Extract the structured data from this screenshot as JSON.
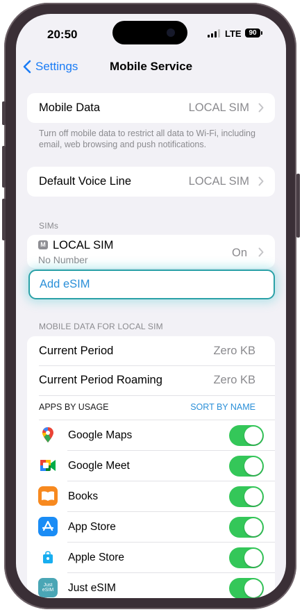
{
  "status_bar": {
    "time": "20:50",
    "network": "LTE",
    "battery": "90"
  },
  "nav": {
    "back_label": "Settings",
    "title": "Mobile Service"
  },
  "mobile_data": {
    "label": "Mobile Data",
    "value": "LOCAL SIM"
  },
  "mobile_data_footnote": "Turn off mobile data to restrict all data to Wi-Fi, including email, web browsing and push notifications.",
  "default_voice": {
    "label": "Default Voice Line",
    "value": "LOCAL SIM"
  },
  "sims": {
    "header": "SIMs",
    "sim": {
      "badge": "M",
      "name": "LOCAL SIM",
      "number": "No Number",
      "status": "On"
    },
    "add_esim": "Add eSIM"
  },
  "usage": {
    "header": "MOBILE DATA FOR LOCAL SIM",
    "current_period": {
      "label": "Current Period",
      "value": "Zero KB"
    },
    "current_period_roaming": {
      "label": "Current Period Roaming",
      "value": "Zero KB"
    },
    "apps_header": "APPS BY USAGE",
    "sort_label": "SORT BY NAME",
    "apps": [
      {
        "name": "Google Maps",
        "icon": "google-maps-icon",
        "enabled": true
      },
      {
        "name": "Google Meet",
        "icon": "google-meet-icon",
        "enabled": true
      },
      {
        "name": "Books",
        "icon": "books-icon",
        "enabled": true
      },
      {
        "name": "App Store",
        "icon": "app-store-icon",
        "enabled": true
      },
      {
        "name": "Apple Store",
        "icon": "apple-store-icon",
        "enabled": true
      },
      {
        "name": "Just eSIM",
        "icon": "just-esim-icon",
        "icon_text": "Just eSIM",
        "enabled": true
      }
    ]
  },
  "colors": {
    "accent": "#1a7cf5",
    "toggle_on": "#34c759",
    "highlight": "#2aa1a7"
  }
}
